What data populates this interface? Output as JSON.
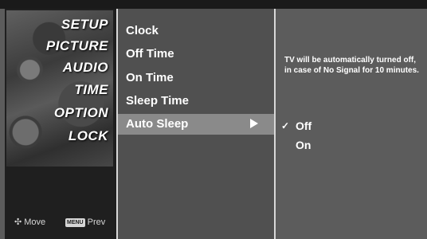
{
  "categories": [
    {
      "label": "SETUP"
    },
    {
      "label": "PICTURE"
    },
    {
      "label": "AUDIO"
    },
    {
      "label": "TIME"
    },
    {
      "label": "OPTION"
    },
    {
      "label": "LOCK"
    }
  ],
  "hints": {
    "move_label": "Move",
    "prev_key": "MENU",
    "prev_label": "Prev"
  },
  "menu": {
    "items": [
      {
        "label": "Clock"
      },
      {
        "label": "Off Time"
      },
      {
        "label": "On Time"
      },
      {
        "label": "Sleep Time"
      },
      {
        "label": "Auto Sleep"
      }
    ],
    "selected_index": 4
  },
  "detail": {
    "description": "TV will be automatically turned off, in case of No Signal for 10 minutes.",
    "options": [
      {
        "label": "Off",
        "checked": true
      },
      {
        "label": "On",
        "checked": false
      }
    ]
  },
  "colors": {
    "selected_row": "#8a8a8a",
    "menu_bg": "#505050",
    "category_bg": "#1f1f1f",
    "detail_bg": "#5c5c5c"
  }
}
